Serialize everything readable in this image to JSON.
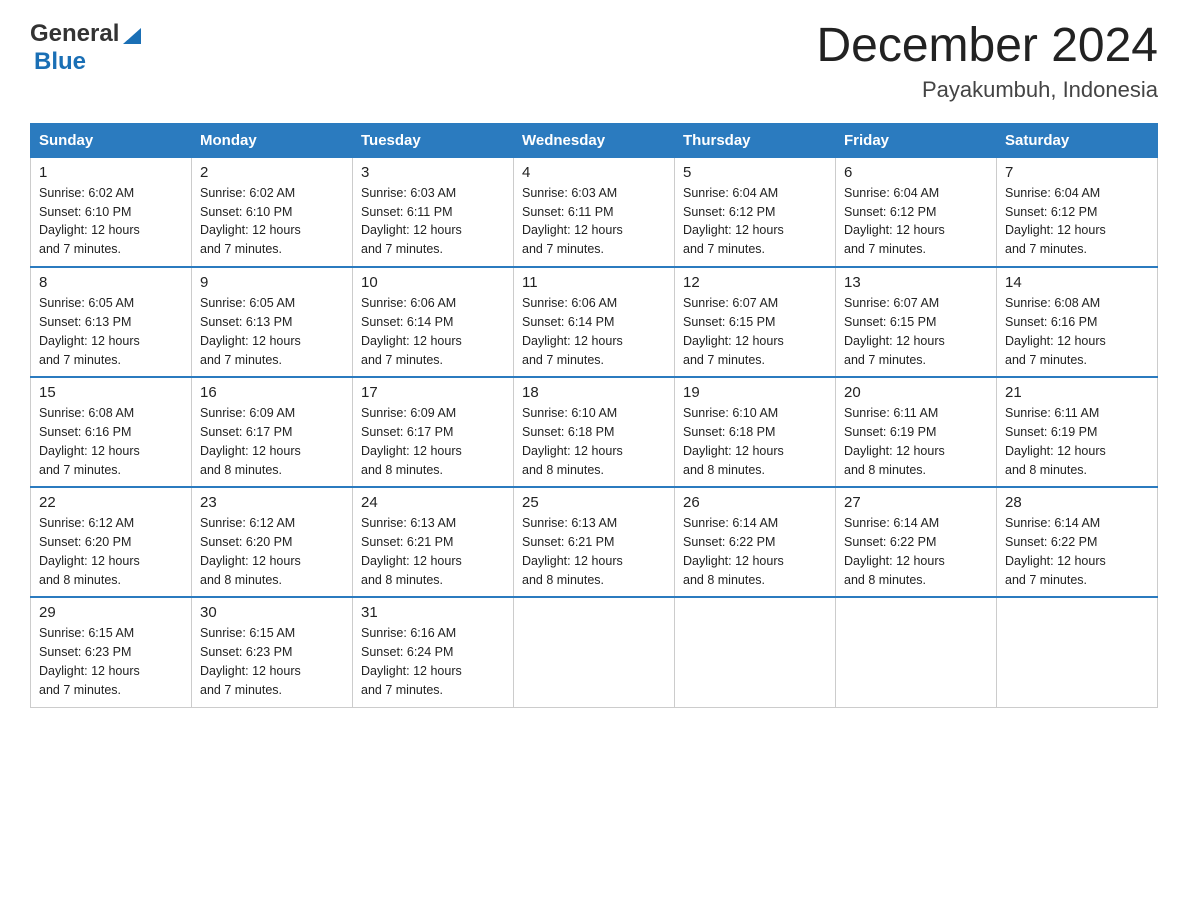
{
  "header": {
    "logo_general": "General",
    "logo_blue": "Blue",
    "month_title": "December 2024",
    "location": "Payakumbuh, Indonesia"
  },
  "days_of_week": [
    "Sunday",
    "Monday",
    "Tuesday",
    "Wednesday",
    "Thursday",
    "Friday",
    "Saturday"
  ],
  "weeks": [
    [
      {
        "day": "1",
        "info": "Sunrise: 6:02 AM\nSunset: 6:10 PM\nDaylight: 12 hours\nand 7 minutes."
      },
      {
        "day": "2",
        "info": "Sunrise: 6:02 AM\nSunset: 6:10 PM\nDaylight: 12 hours\nand 7 minutes."
      },
      {
        "day": "3",
        "info": "Sunrise: 6:03 AM\nSunset: 6:11 PM\nDaylight: 12 hours\nand 7 minutes."
      },
      {
        "day": "4",
        "info": "Sunrise: 6:03 AM\nSunset: 6:11 PM\nDaylight: 12 hours\nand 7 minutes."
      },
      {
        "day": "5",
        "info": "Sunrise: 6:04 AM\nSunset: 6:12 PM\nDaylight: 12 hours\nand 7 minutes."
      },
      {
        "day": "6",
        "info": "Sunrise: 6:04 AM\nSunset: 6:12 PM\nDaylight: 12 hours\nand 7 minutes."
      },
      {
        "day": "7",
        "info": "Sunrise: 6:04 AM\nSunset: 6:12 PM\nDaylight: 12 hours\nand 7 minutes."
      }
    ],
    [
      {
        "day": "8",
        "info": "Sunrise: 6:05 AM\nSunset: 6:13 PM\nDaylight: 12 hours\nand 7 minutes."
      },
      {
        "day": "9",
        "info": "Sunrise: 6:05 AM\nSunset: 6:13 PM\nDaylight: 12 hours\nand 7 minutes."
      },
      {
        "day": "10",
        "info": "Sunrise: 6:06 AM\nSunset: 6:14 PM\nDaylight: 12 hours\nand 7 minutes."
      },
      {
        "day": "11",
        "info": "Sunrise: 6:06 AM\nSunset: 6:14 PM\nDaylight: 12 hours\nand 7 minutes."
      },
      {
        "day": "12",
        "info": "Sunrise: 6:07 AM\nSunset: 6:15 PM\nDaylight: 12 hours\nand 7 minutes."
      },
      {
        "day": "13",
        "info": "Sunrise: 6:07 AM\nSunset: 6:15 PM\nDaylight: 12 hours\nand 7 minutes."
      },
      {
        "day": "14",
        "info": "Sunrise: 6:08 AM\nSunset: 6:16 PM\nDaylight: 12 hours\nand 7 minutes."
      }
    ],
    [
      {
        "day": "15",
        "info": "Sunrise: 6:08 AM\nSunset: 6:16 PM\nDaylight: 12 hours\nand 7 minutes."
      },
      {
        "day": "16",
        "info": "Sunrise: 6:09 AM\nSunset: 6:17 PM\nDaylight: 12 hours\nand 8 minutes."
      },
      {
        "day": "17",
        "info": "Sunrise: 6:09 AM\nSunset: 6:17 PM\nDaylight: 12 hours\nand 8 minutes."
      },
      {
        "day": "18",
        "info": "Sunrise: 6:10 AM\nSunset: 6:18 PM\nDaylight: 12 hours\nand 8 minutes."
      },
      {
        "day": "19",
        "info": "Sunrise: 6:10 AM\nSunset: 6:18 PM\nDaylight: 12 hours\nand 8 minutes."
      },
      {
        "day": "20",
        "info": "Sunrise: 6:11 AM\nSunset: 6:19 PM\nDaylight: 12 hours\nand 8 minutes."
      },
      {
        "day": "21",
        "info": "Sunrise: 6:11 AM\nSunset: 6:19 PM\nDaylight: 12 hours\nand 8 minutes."
      }
    ],
    [
      {
        "day": "22",
        "info": "Sunrise: 6:12 AM\nSunset: 6:20 PM\nDaylight: 12 hours\nand 8 minutes."
      },
      {
        "day": "23",
        "info": "Sunrise: 6:12 AM\nSunset: 6:20 PM\nDaylight: 12 hours\nand 8 minutes."
      },
      {
        "day": "24",
        "info": "Sunrise: 6:13 AM\nSunset: 6:21 PM\nDaylight: 12 hours\nand 8 minutes."
      },
      {
        "day": "25",
        "info": "Sunrise: 6:13 AM\nSunset: 6:21 PM\nDaylight: 12 hours\nand 8 minutes."
      },
      {
        "day": "26",
        "info": "Sunrise: 6:14 AM\nSunset: 6:22 PM\nDaylight: 12 hours\nand 8 minutes."
      },
      {
        "day": "27",
        "info": "Sunrise: 6:14 AM\nSunset: 6:22 PM\nDaylight: 12 hours\nand 8 minutes."
      },
      {
        "day": "28",
        "info": "Sunrise: 6:14 AM\nSunset: 6:22 PM\nDaylight: 12 hours\nand 7 minutes."
      }
    ],
    [
      {
        "day": "29",
        "info": "Sunrise: 6:15 AM\nSunset: 6:23 PM\nDaylight: 12 hours\nand 7 minutes."
      },
      {
        "day": "30",
        "info": "Sunrise: 6:15 AM\nSunset: 6:23 PM\nDaylight: 12 hours\nand 7 minutes."
      },
      {
        "day": "31",
        "info": "Sunrise: 6:16 AM\nSunset: 6:24 PM\nDaylight: 12 hours\nand 7 minutes."
      },
      {
        "day": "",
        "info": ""
      },
      {
        "day": "",
        "info": ""
      },
      {
        "day": "",
        "info": ""
      },
      {
        "day": "",
        "info": ""
      }
    ]
  ]
}
